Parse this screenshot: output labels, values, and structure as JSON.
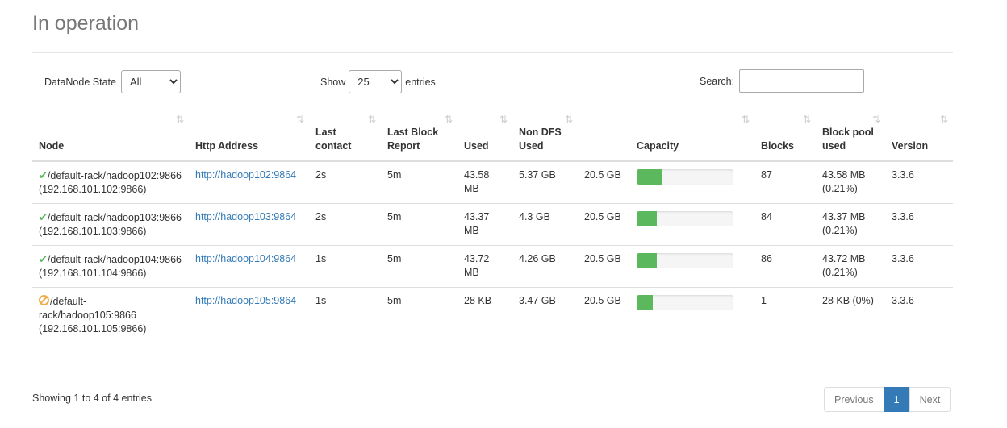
{
  "title": "In operation",
  "filter": {
    "label": "DataNode State",
    "value": "All"
  },
  "length": {
    "show_label": "Show",
    "value": "25",
    "entries_label": "entries"
  },
  "search": {
    "label": "Search:",
    "value": ""
  },
  "columns": [
    "Node",
    "Http Address",
    "Last contact",
    "Last Block Report",
    "Used",
    "Non DFS Used",
    "",
    "Capacity",
    "Blocks",
    "Block pool used",
    "Version"
  ],
  "sort_icon": "⇅",
  "rows": [
    {
      "status": "ok",
      "status_glyph": "✔",
      "node": "/default-rack/hadoop102:9866 (192.168.101.102:9866)",
      "http": "http://hadoop102:9864",
      "last_contact": "2s",
      "last_block_report": "5m",
      "used": "43.58 MB",
      "non_dfs_used": "5.37 GB",
      "capacity_text": "20.5 GB",
      "capacity_used_pct": 26,
      "blocks": "87",
      "block_pool_used": "43.58 MB (0.21%)",
      "version": "3.3.6"
    },
    {
      "status": "ok",
      "status_glyph": "✔",
      "node": "/default-rack/hadoop103:9866 (192.168.101.103:9866)",
      "http": "http://hadoop103:9864",
      "last_contact": "2s",
      "last_block_report": "5m",
      "used": "43.37 MB",
      "non_dfs_used": "4.3 GB",
      "capacity_text": "20.5 GB",
      "capacity_used_pct": 21,
      "blocks": "84",
      "block_pool_used": "43.37 MB (0.21%)",
      "version": "3.3.6"
    },
    {
      "status": "ok",
      "status_glyph": "✔",
      "node": "/default-rack/hadoop104:9866 (192.168.101.104:9866)",
      "http": "http://hadoop104:9864",
      "last_contact": "1s",
      "last_block_report": "5m",
      "used": "43.72 MB",
      "non_dfs_used": "4.26 GB",
      "capacity_text": "20.5 GB",
      "capacity_used_pct": 21,
      "blocks": "86",
      "block_pool_used": "43.72 MB (0.21%)",
      "version": "3.3.6"
    },
    {
      "status": "warn",
      "status_glyph": "",
      "node": "/default-rack/hadoop105:9866 (192.168.101.105:9866)",
      "http": "http://hadoop105:9864",
      "last_contact": "1s",
      "last_block_report": "5m",
      "used": "28 KB",
      "non_dfs_used": "3.47 GB",
      "capacity_text": "20.5 GB",
      "capacity_used_pct": 17,
      "blocks": "1",
      "block_pool_used": "28 KB (0%)",
      "version": "3.3.6"
    }
  ],
  "info": "Showing 1 to 4 of 4 entries",
  "pager": {
    "prev": "Previous",
    "page": "1",
    "next": "Next"
  },
  "colors": {
    "accent": "#337ab7",
    "success": "#5cb85c",
    "warning": "#f0ad4e"
  }
}
